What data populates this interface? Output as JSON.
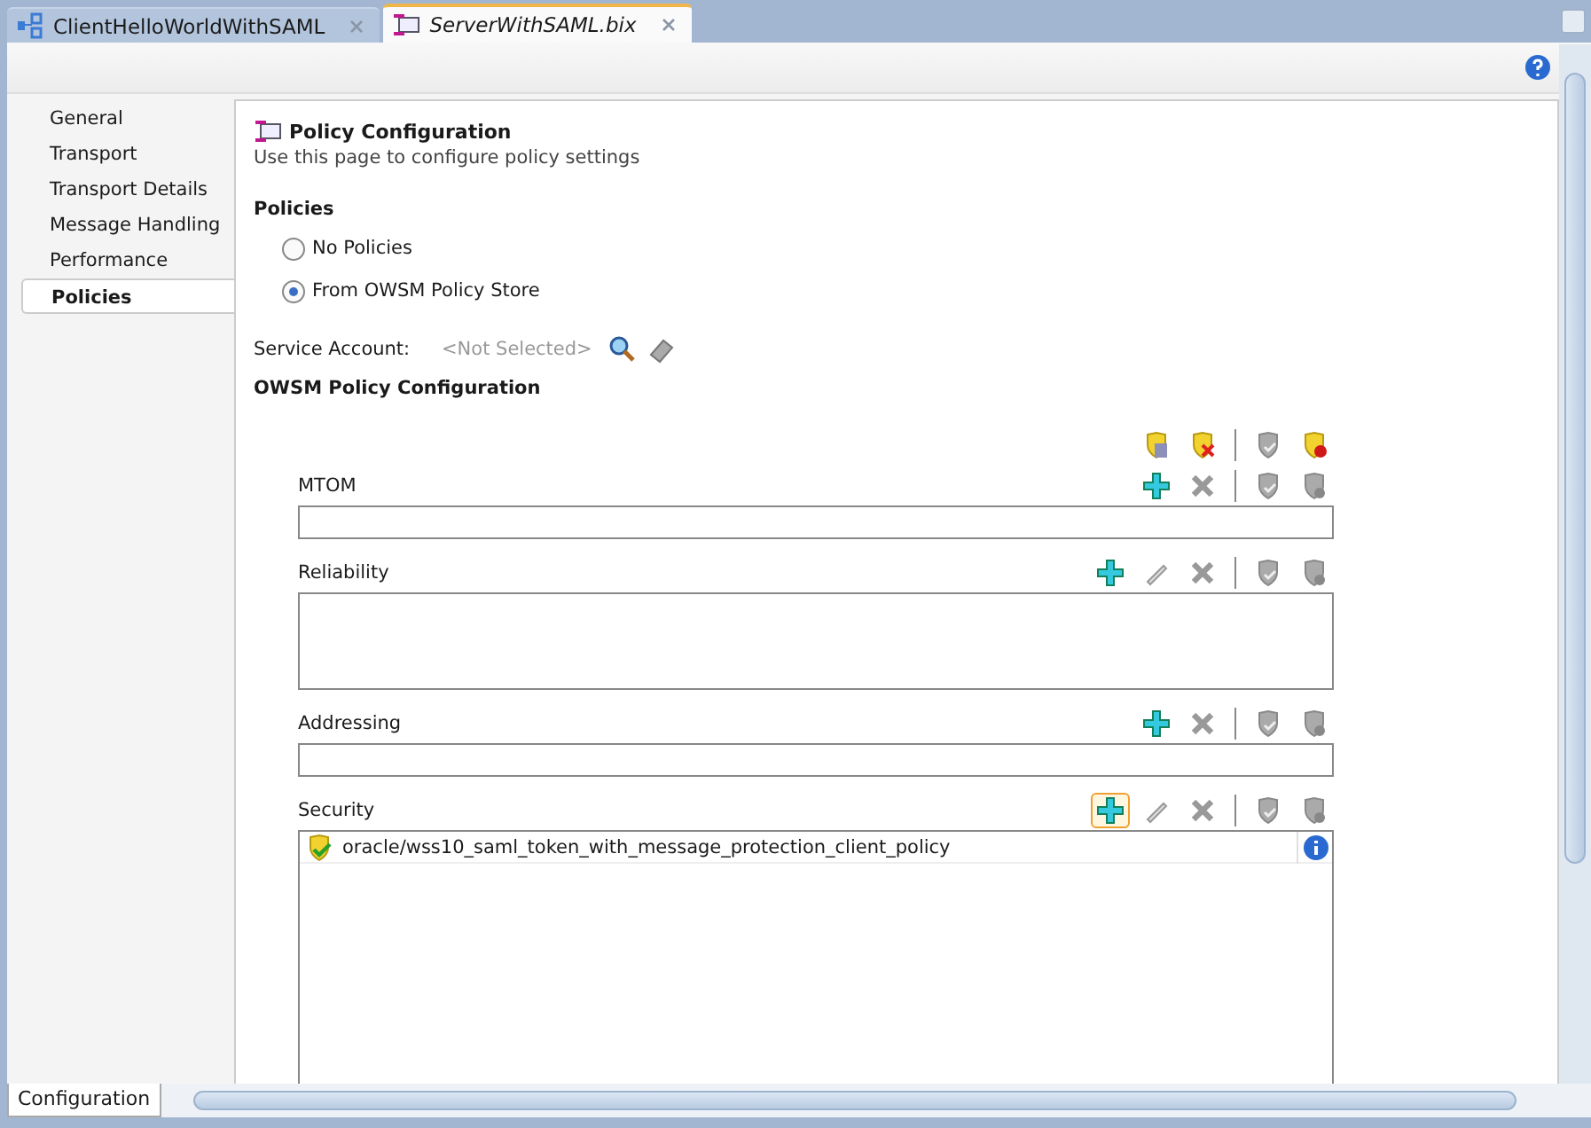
{
  "editor_tabs": [
    {
      "label": "ClientHelloWorldWithSAML",
      "kind": "diagram",
      "selected": false,
      "italic": false
    },
    {
      "label": "ServerWithSAML.bix",
      "kind": "envelope",
      "selected": true,
      "italic": true
    }
  ],
  "nav": [
    {
      "label": "General",
      "selected": false
    },
    {
      "label": "Transport",
      "selected": false
    },
    {
      "label": "Transport Details",
      "selected": false
    },
    {
      "label": "Message Handling",
      "selected": false
    },
    {
      "label": "Performance",
      "selected": false
    },
    {
      "label": "Policies",
      "selected": true
    }
  ],
  "page": {
    "title": "Policy Configuration",
    "subtitle": "Use this page to configure policy settings"
  },
  "policies": {
    "heading": "Policies",
    "options": [
      {
        "label": "No Policies",
        "selected": false
      },
      {
        "label": "From OWSM Policy Store",
        "selected": true
      }
    ]
  },
  "service_account": {
    "label": "Service Account:",
    "value": "<Not Selected>"
  },
  "owsm": {
    "heading": "OWSM Policy Configuration",
    "tools": [
      {
        "kind": "shields-door"
      },
      {
        "kind": "shields-cross"
      },
      {
        "kind": "shields-check"
      },
      {
        "kind": "shields-stop"
      }
    ],
    "sections": [
      {
        "label": "MTOM",
        "kind": "single",
        "tools": [
          {
            "kind": "add",
            "focused": false
          },
          {
            "kind": "delete",
            "focused": false
          },
          {
            "kind": "attach",
            "focused": false
          },
          {
            "kind": "detach",
            "focused": false
          }
        ]
      },
      {
        "label": "Reliability",
        "kind": "multi",
        "tools": [
          {
            "kind": "add",
            "focused": false
          },
          {
            "kind": "edit",
            "focused": false
          },
          {
            "kind": "delete",
            "focused": false
          },
          {
            "kind": "attach",
            "focused": false
          },
          {
            "kind": "detach",
            "focused": false
          }
        ]
      },
      {
        "label": "Addressing",
        "kind": "single",
        "tools": [
          {
            "kind": "add",
            "focused": false
          },
          {
            "kind": "delete",
            "focused": false
          },
          {
            "kind": "attach",
            "focused": false
          },
          {
            "kind": "detach",
            "focused": false
          }
        ]
      },
      {
        "label": "Security",
        "kind": "tall",
        "tools": [
          {
            "kind": "add",
            "focused": true
          },
          {
            "kind": "edit",
            "focused": false
          },
          {
            "kind": "delete",
            "focused": false
          },
          {
            "kind": "attach",
            "focused": false
          },
          {
            "kind": "detach",
            "focused": false
          }
        ],
        "rows": [
          {
            "name": "oracle/wss10_saml_token_with_message_protection_client_policy"
          }
        ]
      }
    ]
  },
  "bottom_tabs": [
    {
      "label": "Configuration",
      "selected": true
    }
  ]
}
